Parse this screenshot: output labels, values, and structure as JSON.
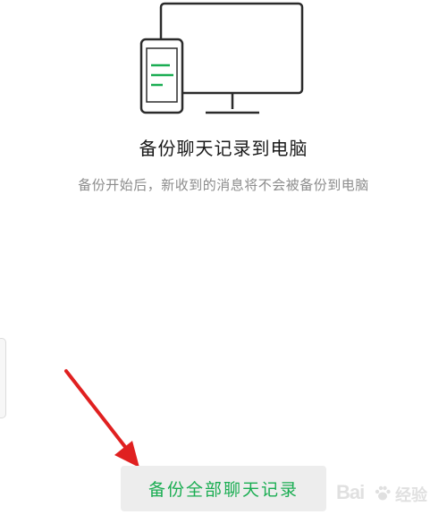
{
  "dialog": {
    "title": "备份聊天记录到电脑",
    "subtitle": "备份开始后，新收到的消息将不会被备份到电脑",
    "backup_button_label": "备份全部聊天记录"
  },
  "illustration": {
    "icon": "phone-to-computer-icon",
    "accent_color": "#1aad52",
    "stroke_color": "#2b2b2b"
  },
  "annotation": {
    "icon": "red-arrow-icon",
    "color": "#e02020"
  },
  "watermark": {
    "brand_text": "Bai",
    "brand_suffix": "经验",
    "icon": "baidu-paw-icon"
  },
  "colors": {
    "primary_green": "#1aad52",
    "button_bg": "#ededed",
    "subtitle_gray": "#8c8c8c"
  }
}
